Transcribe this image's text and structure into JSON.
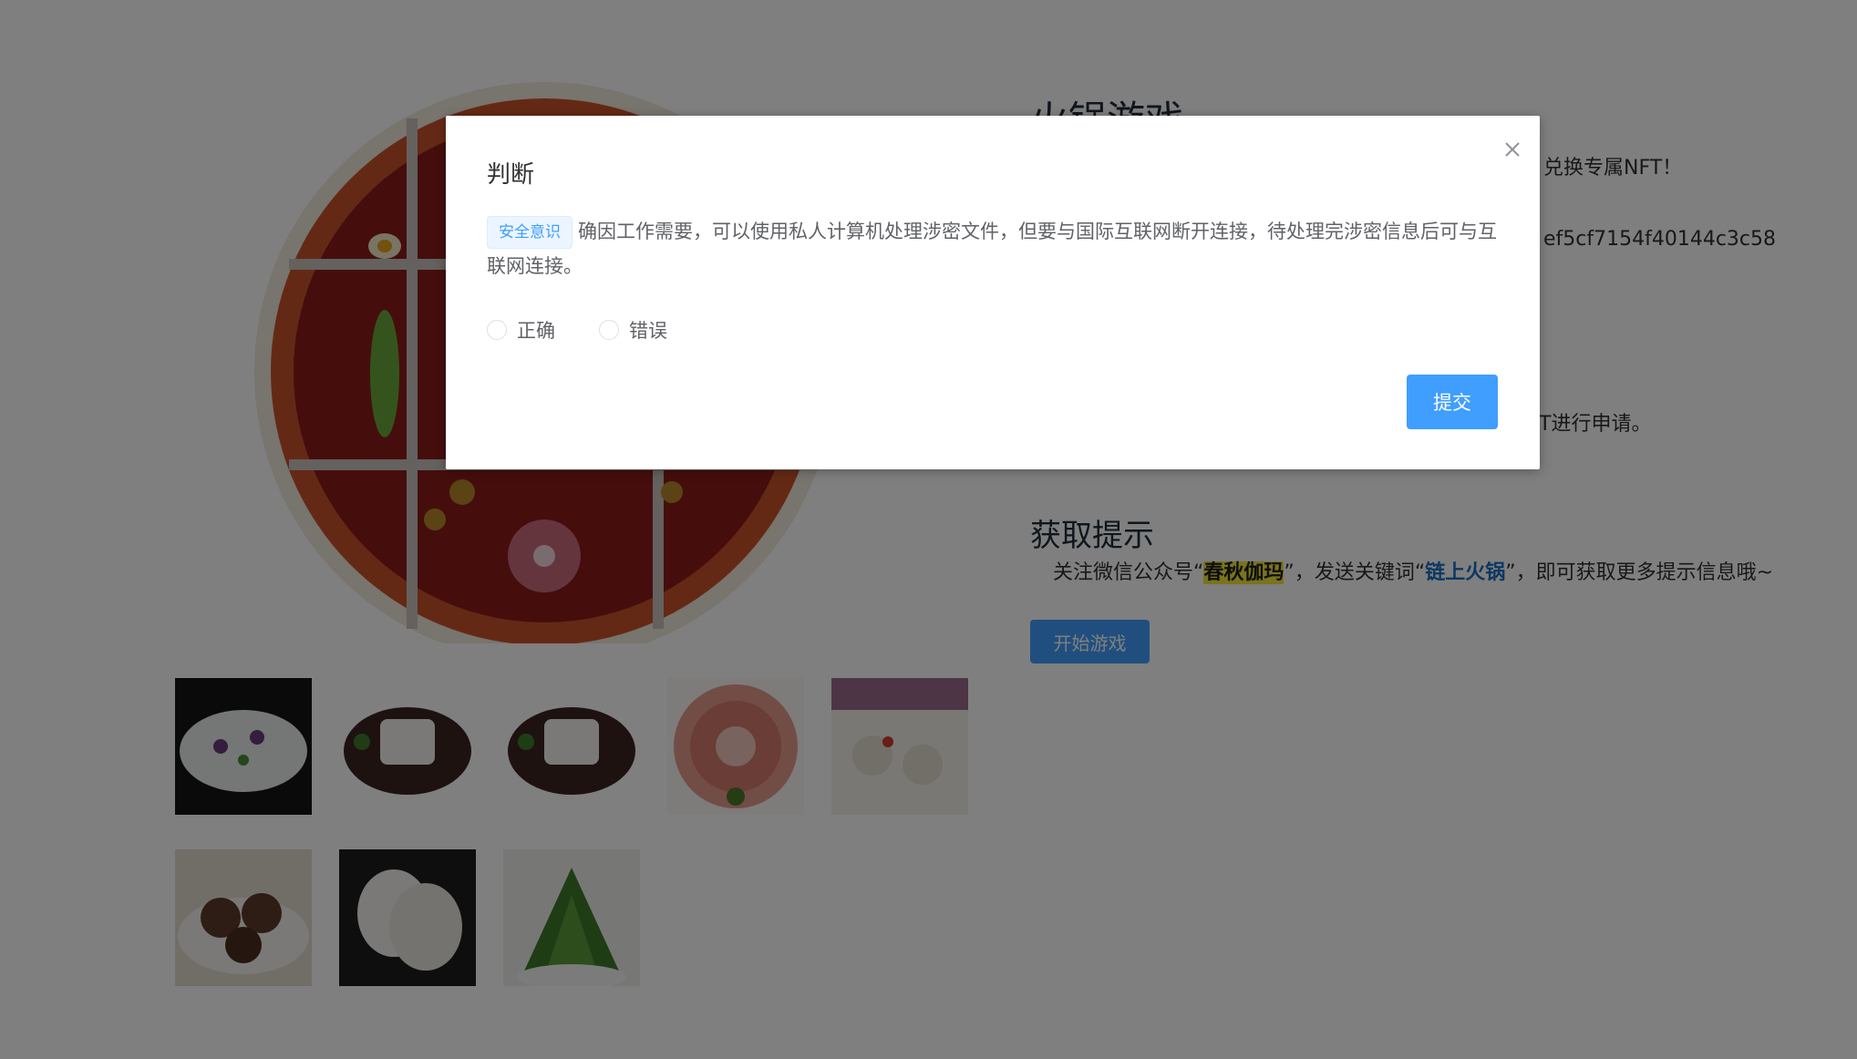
{
  "game": {
    "title": "火锅游戏",
    "line1": "兑换专属NFT！",
    "line2": "ef5cf7154f40144c3c58",
    "line3": "T进行申请。"
  },
  "hint": {
    "title": "获取提示",
    "prefix": "关注微信公众号“",
    "account": "春秋伽玛",
    "middle": "”，发送关键词“",
    "keyword": "链上火锅",
    "suffix": "”，即可获取更多提示信息哦~",
    "account_color": "#f5e83a",
    "keyword_color": "#1b6ec2"
  },
  "start_button": {
    "label": "开始游戏",
    "color": "#409eff"
  },
  "thumbnails": [
    {
      "icon": "shrimp-paste-icon"
    },
    {
      "icon": "rice-cake-plate-icon"
    },
    {
      "icon": "rice-cake-plate-icon"
    },
    {
      "icon": "sliced-lamb-icon"
    },
    {
      "icon": "lotus-root-slices-icon"
    },
    {
      "icon": "shiitake-mushroom-icon"
    },
    {
      "icon": "white-radish-slices-icon"
    },
    {
      "icon": "leafy-greens-icon"
    }
  ],
  "dialog": {
    "title": "判断",
    "tag": "安全意识",
    "question": "确因工作需要，可以使用私人计算机处理涉密文件，但要与国际互联网断开连接，待处理完涉密信息后可与互联网连接。",
    "options": [
      "正确",
      "错误"
    ],
    "submit_label": "提交",
    "close_icon": "close-icon",
    "accent": "#409eff"
  }
}
